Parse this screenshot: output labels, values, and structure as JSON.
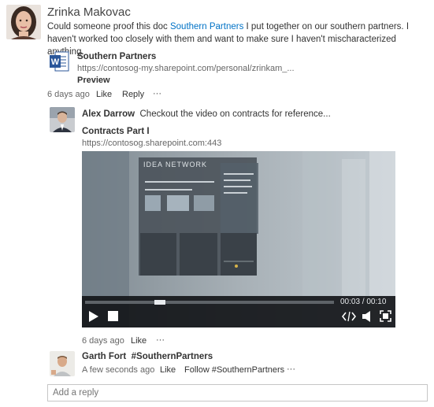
{
  "post": {
    "author": "Zrinka Makovac",
    "text_before": "Could someone proof this doc ",
    "link_text": "Southern Partners",
    "text_after": " I put together on our southern partners.  I haven't worked too closely with them and want to make sure I haven't mischaracterized anything.",
    "attachment": {
      "icon": "word-doc-icon",
      "title": "Southern Partners",
      "url": "https://contosog-my.sharepoint.com/personal/zrinkam_...",
      "preview_label": "Preview"
    },
    "time": "6 days ago",
    "like_label": "Like",
    "reply_label": "Reply",
    "more_label": "···"
  },
  "reply1": {
    "author": "Alex Darrow",
    "text": "Checkout the video on contracts for reference...",
    "video": {
      "title": "Contracts Part I",
      "url": "https://contosog.sharepoint.com:443",
      "slide_title": "IDEA NETWORK",
      "time_display": "00:03 / 00:10",
      "progress": 0.3
    },
    "time": "6 days ago",
    "like_label": "Like",
    "more_label": "···"
  },
  "reply2": {
    "author": "Garth Fort",
    "hashtag": "#SouthernPartners",
    "time": "A few seconds ago",
    "like_label": "Like",
    "follow_label": "Follow #SouthernPartners",
    "more_label": "···"
  },
  "reply_box": {
    "placeholder": "Add a reply"
  }
}
